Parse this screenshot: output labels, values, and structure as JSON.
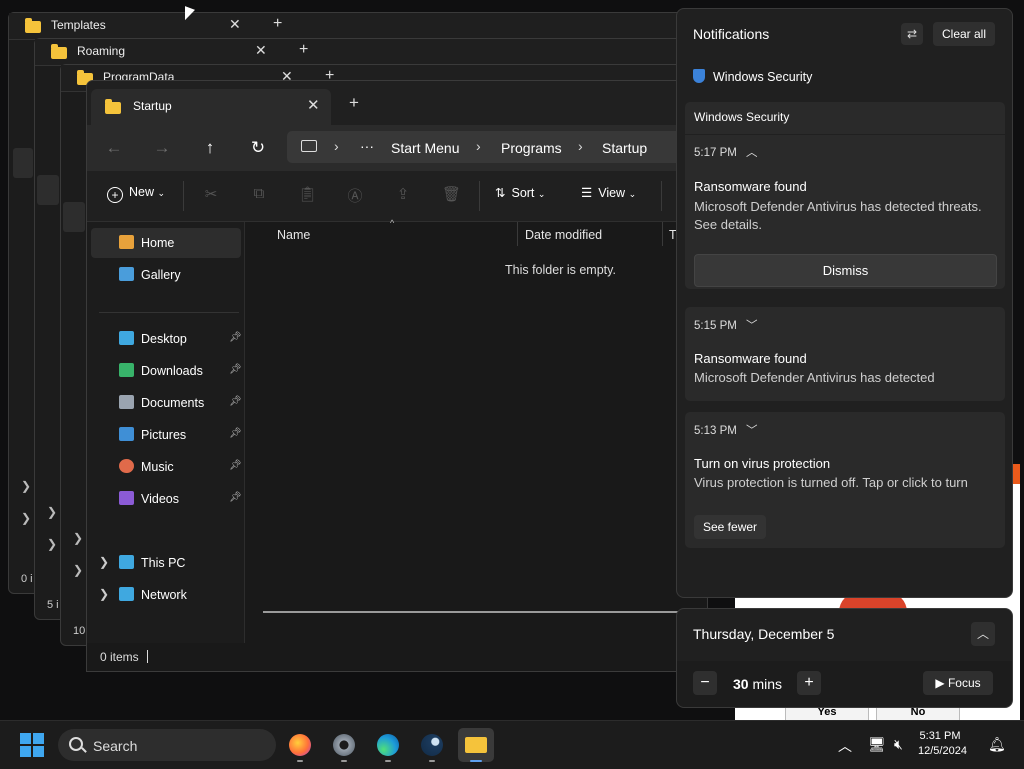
{
  "background_windows": [
    {
      "tab": "Templates",
      "status": "0 i"
    },
    {
      "tab": "Roaming",
      "status": "5 i"
    },
    {
      "tab": "ProgramData",
      "status": "10"
    }
  ],
  "explorer": {
    "tab_title": "Startup",
    "breadcrumb": {
      "more": "···",
      "items": [
        "Start Menu",
        "Programs",
        "Startup"
      ]
    },
    "toolbar": {
      "new_label": "New",
      "sort_label": "Sort",
      "view_label": "View"
    },
    "nav": {
      "top": [
        {
          "label": "Home",
          "icon": "home-icon",
          "color": "#e8a23b"
        },
        {
          "label": "Gallery",
          "icon": "gallery-icon",
          "color": "#4a9ddb"
        }
      ],
      "pinned": [
        {
          "label": "Desktop",
          "icon": "desktop-icon",
          "color": "#3fa8e0"
        },
        {
          "label": "Downloads",
          "icon": "downloads-icon",
          "color": "#38b36a"
        },
        {
          "label": "Documents",
          "icon": "documents-icon",
          "color": "#9aa4b0"
        },
        {
          "label": "Pictures",
          "icon": "pictures-icon",
          "color": "#3f8fd6"
        },
        {
          "label": "Music",
          "icon": "music-icon",
          "color": "#e06a4a"
        },
        {
          "label": "Videos",
          "icon": "videos-icon",
          "color": "#8b5bd6"
        }
      ],
      "devices": [
        {
          "label": "This PC",
          "icon": "pc-icon",
          "color": "#3fa8e0"
        },
        {
          "label": "Network",
          "icon": "network-icon",
          "color": "#3fa8e0"
        }
      ]
    },
    "columns": {
      "name": "Name",
      "date": "Date modified",
      "type": "Ty"
    },
    "empty_text": "This folder is empty.",
    "status": "0 items"
  },
  "notifications": {
    "header": "Notifications",
    "clear_all": "Clear all",
    "app_name": "Windows Security",
    "items": [
      {
        "source": "Windows Security",
        "time": "5:17 PM",
        "title": "Ransomware found",
        "body": "Microsoft Defender Antivirus has detected threats. See details.",
        "action": "Dismiss"
      },
      {
        "time": "5:15 PM",
        "title": "Ransomware found",
        "body": "Microsoft Defender Antivirus has detected"
      },
      {
        "time": "5:13 PM",
        "title": "Turn on virus protection",
        "body": "Virus protection is turned off. Tap or click to turn",
        "action": "See fewer"
      }
    ]
  },
  "calendar": {
    "date": "Thursday, December 5",
    "focus_value": "30",
    "focus_unit": "mins",
    "focus_label": "Focus"
  },
  "dialog_behind": {
    "yes": "Yes",
    "no": "No"
  },
  "taskbar": {
    "search_label": "Search",
    "time": "5:31 PM",
    "date": "12/5/2024"
  }
}
